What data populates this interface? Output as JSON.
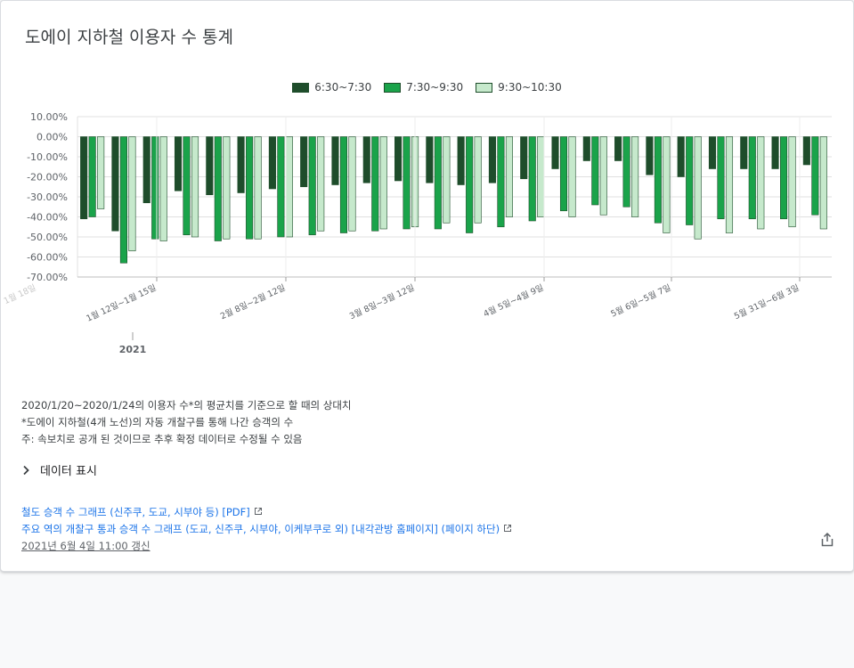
{
  "header": {
    "title": "도에이 지하철 이용자 수 통계"
  },
  "chart_data": {
    "type": "bar",
    "ylim": [
      -70,
      10
    ],
    "yticks": [
      "10.00%",
      "0.00%",
      "-10.00%",
      "-20.00%",
      "-30.00%",
      "-40.00%",
      "-50.00%",
      "-60.00%",
      "-70.00%"
    ],
    "xtick_labels": [
      "1월 18일",
      "1월 12일~1월 15일",
      "2월 8일~2월 12일",
      "3월 8일~3월 12일",
      "4월 5일~4월 9일",
      "5월 6일~5월 7일",
      "5월 31일~6월 3일"
    ],
    "year_label": "2021",
    "series": [
      {
        "name": "6:30~7:30",
        "color": "#1e4d2b",
        "values": [
          -41,
          -47,
          -33,
          -27,
          -29,
          -28,
          -26,
          -25,
          -24,
          -23,
          -22,
          -23,
          -24,
          -23,
          -21,
          -16,
          -12,
          -12,
          -19,
          -20,
          -16,
          -16,
          -16,
          -14
        ]
      },
      {
        "name": "7:30~9:30",
        "color": "#1aa34a",
        "values": [
          -40,
          -63,
          -51,
          -49,
          -52,
          -51,
          -50,
          -49,
          -48,
          -47,
          -46,
          -46,
          -48,
          -45,
          -42,
          -37,
          -34,
          -35,
          -43,
          -44,
          -41,
          -41,
          -41,
          -39
        ]
      },
      {
        "name": "9:30~10:30",
        "color": "#c6e9cc",
        "values": [
          -36,
          -57,
          -52,
          -50,
          -51,
          -51,
          -50,
          -47,
          -47,
          -46,
          -45,
          -43,
          -43,
          -40,
          -40,
          -40,
          -39,
          -40,
          -48,
          -51,
          -48,
          -46,
          -45,
          -46
        ]
      }
    ]
  },
  "notes": {
    "line1": "2020/1/20~2020/1/24의 이용자 수*의 평균치를 기준으로 할 때의 상대치",
    "line2": "*도에이 지하철(4개 노선)의 자동 개찰구를 통해 나간 승객의 수",
    "line3": "주: 속보치로 공개 된 것이므로 추후 확정 데이터로 수정될 수 있음"
  },
  "toggle": {
    "label": "데이터 표시"
  },
  "links": {
    "link1": "철도 승객 수 그래프 (신주쿠, 도교, 시부야 등) [PDF]",
    "link2": "주요 역의 개찰구 통과 승객 수 그래프 (도교, 신주쿠, 시부야, 이케부쿠로 외) [내각관방 홈페이지] (페이지 하단)",
    "updated": "2021년 6월 4일 11:00 갱신"
  },
  "icons": {
    "toggle": "chevron-right-icon",
    "external": "external-link-icon",
    "share": "share-icon"
  }
}
